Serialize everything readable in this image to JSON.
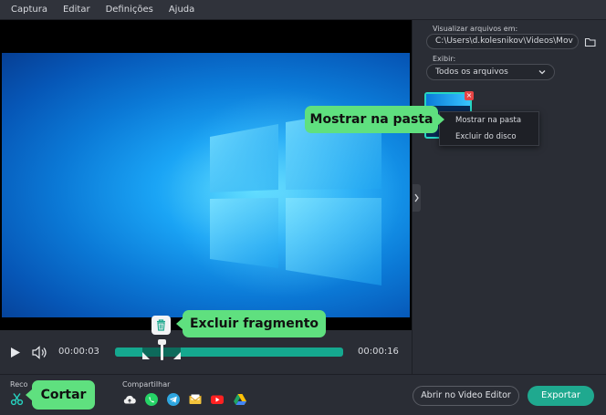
{
  "menu": {
    "items": [
      "Captura",
      "Editar",
      "Definições",
      "Ajuda"
    ]
  },
  "right_panel": {
    "browse_label": "Visualizar arquivos em:",
    "path_value": "C:\\Users\\d.kolesnikov\\Videos\\Mov",
    "show_label": "Exibir:",
    "filter_value": "Todos os arquivos",
    "context_menu": {
      "show_in_folder": "Mostrar na pasta",
      "delete_from_disk": "Excluir do disco"
    }
  },
  "player": {
    "current_time": "00:00:03",
    "total_time": "00:00:16",
    "playhead_fraction": 0.2
  },
  "bottom": {
    "record_label": "Reco",
    "share_label": "Compartilhar",
    "share_icons": [
      "cloud-icon",
      "whatsapp-icon",
      "telegram-icon",
      "email-icon",
      "youtube-icon",
      "google-drive-icon"
    ],
    "open_editor_label": "Abrir no Video Editor",
    "export_label": "Exportar"
  },
  "callouts": {
    "show_in_folder": "Mostrar na pasta",
    "delete_fragment": "Excluir fragmento",
    "cut": "Cortar"
  },
  "colors": {
    "accent": "#1fa98f",
    "callout": "#5fe07f",
    "background": "#2a2d35"
  }
}
